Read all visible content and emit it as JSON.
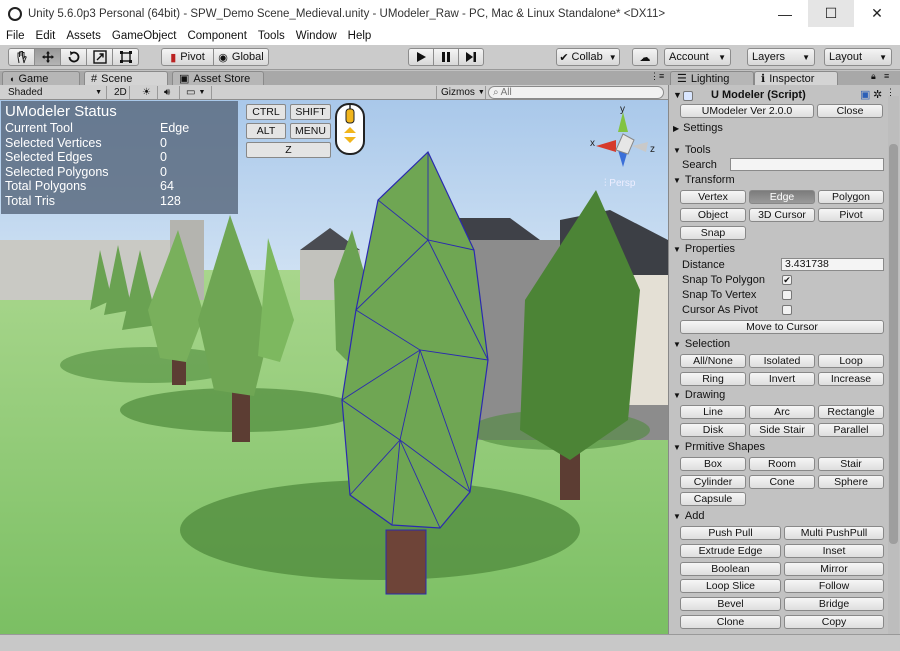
{
  "window": {
    "title": "Unity 5.6.0p3 Personal (64bit) - SPW_Demo Scene_Medieval.unity - UModeler_Raw - PC, Mac & Linux Standalone* <DX11>",
    "minimize": "—",
    "maximize": "☐",
    "close": "✕"
  },
  "menu": [
    "File",
    "Edit",
    "Assets",
    "GameObject",
    "Component",
    "Tools",
    "Window",
    "Help"
  ],
  "toolbar": {
    "pivot": "Pivot",
    "global": "Global",
    "collab": "Collab",
    "account": "Account",
    "layers": "Layers",
    "layout": "Layout"
  },
  "tabs": {
    "game": "Game",
    "scene": "Scene",
    "asset_store": "Asset Store",
    "lighting": "Lighting",
    "inspector": "Inspector"
  },
  "scene_bar": {
    "shading": "Shaded",
    "mode2d": "2D",
    "gizmos": "Gizmos",
    "search_placeholder": "All"
  },
  "status": {
    "title": "UModeler Status",
    "rows": [
      {
        "k": "Current Tool",
        "v": "Edge"
      },
      {
        "k": "Selected Vertices",
        "v": "0"
      },
      {
        "k": "Selected Edges",
        "v": "0"
      },
      {
        "k": "Selected Polygons",
        "v": "0"
      },
      {
        "k": "Total Polygons",
        "v": "64"
      },
      {
        "k": "Total Tris",
        "v": "128"
      }
    ]
  },
  "hotkeys": {
    "ctrl": "CTRL",
    "shift": "SHIFT",
    "alt": "ALT",
    "menu": "MENU",
    "z": "Z"
  },
  "gizmo": {
    "y": "y",
    "x": "x",
    "z": "z",
    "persp": "Persp"
  },
  "inspector": {
    "component": "U Modeler (Script)",
    "version": "UModeler Ver 2.0.0",
    "close": "Close",
    "settings": "Settings",
    "tools": "Tools",
    "search": "Search",
    "transform": "Transform",
    "vertex": "Vertex",
    "edge": "Edge",
    "polygon": "Polygon",
    "object": "Object",
    "cursor3d": "3D Cursor",
    "pivot": "Pivot",
    "snap": "Snap",
    "properties": "Properties",
    "distance_label": "Distance",
    "distance_value": "3.431738",
    "snap_to_polygon": "Snap To Polygon",
    "snap_to_vertex": "Snap To Vertex",
    "cursor_as_pivot": "Cursor As Pivot",
    "move_to_cursor": "Move to Cursor",
    "selection": "Selection",
    "all_none": "All/None",
    "isolated": "Isolated",
    "loop": "Loop",
    "ring": "Ring",
    "invert": "Invert",
    "increase": "Increase",
    "drawing": "Drawing",
    "line": "Line",
    "arc": "Arc",
    "rectangle": "Rectangle",
    "disk": "Disk",
    "side_stair": "Side Stair",
    "parallel": "Parallel",
    "primitive_shapes": "Prmitive Shapes",
    "box": "Box",
    "room": "Room",
    "stair": "Stair",
    "cylinder": "Cylinder",
    "cone": "Cone",
    "sphere": "Sphere",
    "capsule": "Capsule",
    "add": "Add",
    "push_pull": "Push Pull",
    "multi_push_pull": "Multi PushPull",
    "extrude_edge": "Extrude Edge",
    "inset": "Inset",
    "boolean": "Boolean",
    "mirror": "Mirror",
    "loop_slice": "Loop Slice",
    "follow": "Follow",
    "bevel": "Bevel",
    "bridge": "Bridge",
    "clone": "Clone",
    "copy": "Copy"
  }
}
